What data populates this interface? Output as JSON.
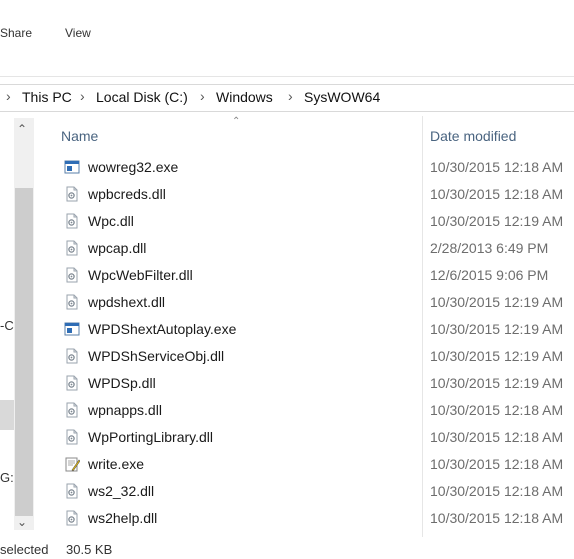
{
  "ribbon": {
    "tabs": [
      "Share",
      "View"
    ]
  },
  "breadcrumb": [
    "This PC",
    "Local Disk (C:)",
    "Windows",
    "SysWOW64"
  ],
  "nav_pane_texts": [
    "-C",
    "G:)"
  ],
  "columns": {
    "name": "Name",
    "date": "Date modified"
  },
  "files": [
    {
      "name": "wowreg32.exe",
      "date": "10/30/2015 12:18 AM",
      "icon": "exe-window-icon"
    },
    {
      "name": "wpbcreds.dll",
      "date": "10/30/2015 12:18 AM",
      "icon": "dll-gear-icon"
    },
    {
      "name": "Wpc.dll",
      "date": "10/30/2015 12:19 AM",
      "icon": "dll-gear-icon"
    },
    {
      "name": "wpcap.dll",
      "date": "2/28/2013 6:49 PM",
      "icon": "dll-gear-icon"
    },
    {
      "name": "WpcWebFilter.dll",
      "date": "12/6/2015 9:06 PM",
      "icon": "dll-gear-icon"
    },
    {
      "name": "wpdshext.dll",
      "date": "10/30/2015 12:19 AM",
      "icon": "dll-gear-icon"
    },
    {
      "name": "WPDShextAutoplay.exe",
      "date": "10/30/2015 12:19 AM",
      "icon": "exe-window-icon"
    },
    {
      "name": "WPDShServiceObj.dll",
      "date": "10/30/2015 12:19 AM",
      "icon": "dll-gear-icon"
    },
    {
      "name": "WPDSp.dll",
      "date": "10/30/2015 12:19 AM",
      "icon": "dll-gear-icon"
    },
    {
      "name": "wpnapps.dll",
      "date": "10/30/2015 12:18 AM",
      "icon": "dll-gear-icon"
    },
    {
      "name": "WpPortingLibrary.dll",
      "date": "10/30/2015 12:18 AM",
      "icon": "dll-gear-icon"
    },
    {
      "name": "write.exe",
      "date": "10/30/2015 12:18 AM",
      "icon": "write-app-icon"
    },
    {
      "name": "ws2_32.dll",
      "date": "10/30/2015 12:18 AM",
      "icon": "dll-gear-icon"
    },
    {
      "name": "ws2help.dll",
      "date": "10/30/2015 12:18 AM",
      "icon": "dll-gear-icon"
    }
  ],
  "status": {
    "selected": "selected",
    "size": "30.5 KB"
  }
}
